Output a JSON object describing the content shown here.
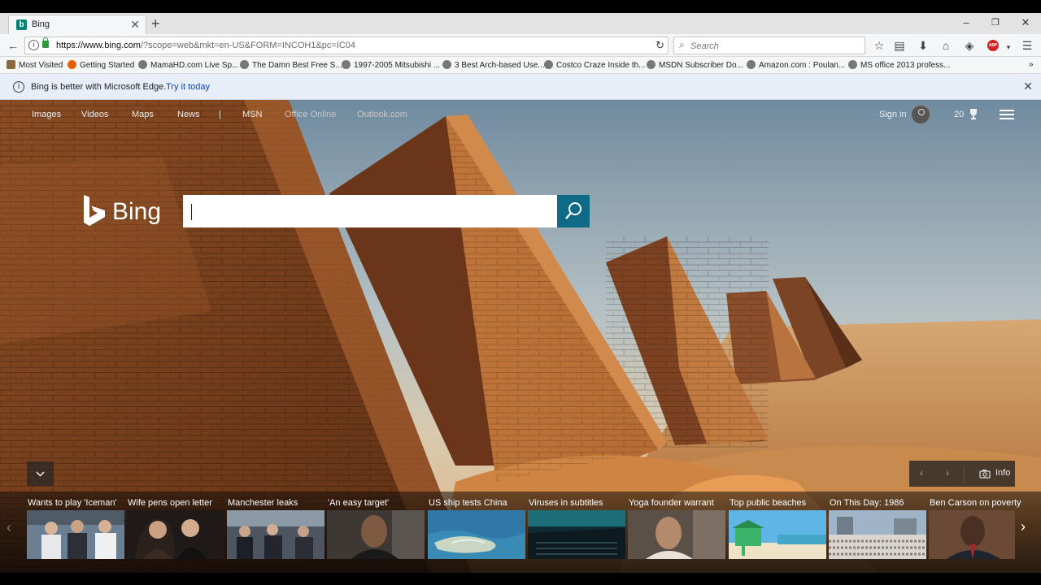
{
  "browser": {
    "tab_title": "Bing",
    "tab_favicon": "b",
    "new_tab": "+",
    "url_host": "https://www.bing.com",
    "url_rest": "/?scope=web&mkt=en-US&FORM=INCOH1&pc=IC04",
    "search_placeholder": "Search",
    "abp_label": "ABP"
  },
  "bookmarks": [
    {
      "label": "Most Visited",
      "icon": "most-visited-icon"
    },
    {
      "label": "Getting Started",
      "icon": "firefox-icon"
    },
    {
      "label": "MamaHD.com Live Sp...",
      "icon": "globe-icon"
    },
    {
      "label": "The Damn Best Free S...",
      "icon": "globe-icon"
    },
    {
      "label": "1997-2005 Mitsubishi ...",
      "icon": "globe-icon"
    },
    {
      "label": "3 Best Arch-based Use...",
      "icon": "globe-icon"
    },
    {
      "label": "Costco Craze Inside th...",
      "icon": "globe-icon"
    },
    {
      "label": "MSDN Subscriber Do...",
      "icon": "globe-icon"
    },
    {
      "label": "Amazon.com : Poulan...",
      "icon": "globe-icon"
    },
    {
      "label": "MS office 2013 profess...",
      "icon": "globe-icon"
    }
  ],
  "notification": {
    "text": "Bing is better with Microsoft Edge.",
    "link": "Try it today"
  },
  "bing": {
    "nav": [
      "Images",
      "Videos",
      "Maps",
      "News",
      "|",
      "MSN",
      "Office Online",
      "Outlook.com"
    ],
    "sign_in": "Sign in",
    "rewards_count": "20",
    "logo_text": "Bing",
    "search_value": "",
    "info_label": "Info",
    "colors": {
      "search_button": "#0f6a88",
      "logo": "#ffffff"
    }
  },
  "news": [
    {
      "caption": "Wants to play 'Iceman'"
    },
    {
      "caption": "Wife pens open letter"
    },
    {
      "caption": "Manchester leaks"
    },
    {
      "caption": "'An easy target'"
    },
    {
      "caption": "US ship tests China"
    },
    {
      "caption": "Viruses in subtitles"
    },
    {
      "caption": "Yoga founder warrant"
    },
    {
      "caption": "Top public beaches"
    },
    {
      "caption": "On This Day: 1986"
    },
    {
      "caption": "Ben Carson on poverty"
    }
  ]
}
